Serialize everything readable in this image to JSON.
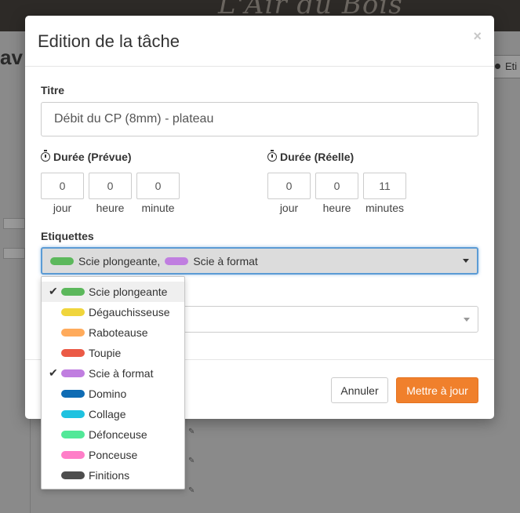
{
  "background": {
    "logo": "L'Air du Bois",
    "heading": "av",
    "right_button": "Eti"
  },
  "modal": {
    "title": "Edition de la tâche",
    "close": "×",
    "title_field": {
      "label": "Titre",
      "value": "Débit du CP (8mm) - plateau"
    },
    "planned": {
      "label": "Durée (Prévue)",
      "values": [
        "0",
        "0",
        "0"
      ],
      "units": [
        "jour",
        "heure",
        "minute"
      ]
    },
    "actual": {
      "label": "Durée (Réelle)",
      "values": [
        "0",
        "0",
        "11"
      ],
      "units": [
        "jour",
        "heure",
        "minutes"
      ]
    },
    "tags": {
      "label": "Etiquettes",
      "selected": [
        {
          "name": "Scie plongeante,",
          "color": "#5cb85c"
        },
        {
          "name": "Scie à format",
          "color": "#c07ee0"
        }
      ]
    },
    "footer": {
      "cancel": "Annuler",
      "update": "Mettre à jour"
    }
  },
  "dropdown": {
    "items": [
      {
        "name": "Scie plongeante",
        "color": "#5cb85c",
        "checked": true,
        "highlighted": true
      },
      {
        "name": "Dégauchisseuse",
        "color": "#f0d53c",
        "checked": false
      },
      {
        "name": "Raboteause",
        "color": "#ffab5c",
        "checked": false
      },
      {
        "name": "Toupie",
        "color": "#eb5a46",
        "checked": false
      },
      {
        "name": "Scie à format",
        "color": "#c07ee0",
        "checked": true
      },
      {
        "name": "Domino",
        "color": "#0f6cb4",
        "checked": false
      },
      {
        "name": "Collage",
        "color": "#1fc2e0",
        "checked": false
      },
      {
        "name": "Défonceuse",
        "color": "#52e898",
        "checked": false
      },
      {
        "name": "Ponceuse",
        "color": "#ff7ec8",
        "checked": false
      },
      {
        "name": "Finitions",
        "color": "#4d4d4d",
        "checked": false
      }
    ]
  }
}
